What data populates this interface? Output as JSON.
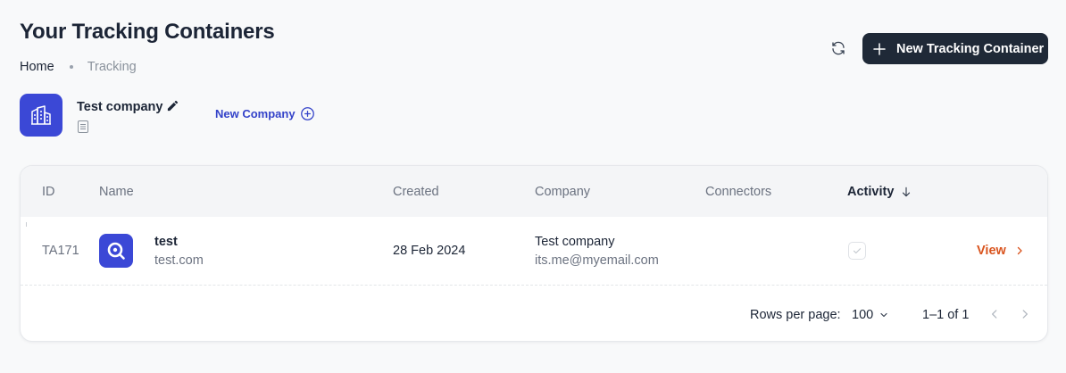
{
  "header": {
    "title": "Your Tracking Containers",
    "breadcrumb": {
      "home": "Home",
      "current": "Tracking"
    },
    "new_container_label": "New Tracking Container"
  },
  "company": {
    "name": "Test company",
    "new_company_label": "New Company"
  },
  "table": {
    "columns": {
      "id": "ID",
      "name": "Name",
      "created": "Created",
      "company": "Company",
      "connectors": "Connectors",
      "activity": "Activity"
    },
    "rows": [
      {
        "id": "TA171",
        "name": "test",
        "domain": "test.com",
        "created": "28 Feb 2024",
        "company": "Test company",
        "email": "its.me@myemail.com",
        "connectors": "",
        "activity_checked": true,
        "action_label": "View"
      }
    ]
  },
  "pagination": {
    "rows_per_page_label": "Rows per page:",
    "rows_per_page_value": "100",
    "range_label": "1–1 of 1"
  },
  "colors": {
    "primary_dark": "#1f2937",
    "brand_blue": "#3b48d6",
    "link_blue": "#3443c9",
    "action_orange": "#d9541e"
  },
  "icons": {
    "refresh": "refresh-icon",
    "plus": "plus-icon",
    "company": "buildings-icon",
    "edit": "pencil-icon",
    "document": "document-icon",
    "add_circle": "plus-circle-icon",
    "sort": "arrow-down-icon",
    "site": "search-magnifier-icon",
    "check": "check-icon",
    "chevron_right": "chevron-right-icon",
    "chevron_down": "chevron-down-icon",
    "chevron_left": "chevron-left-icon"
  }
}
